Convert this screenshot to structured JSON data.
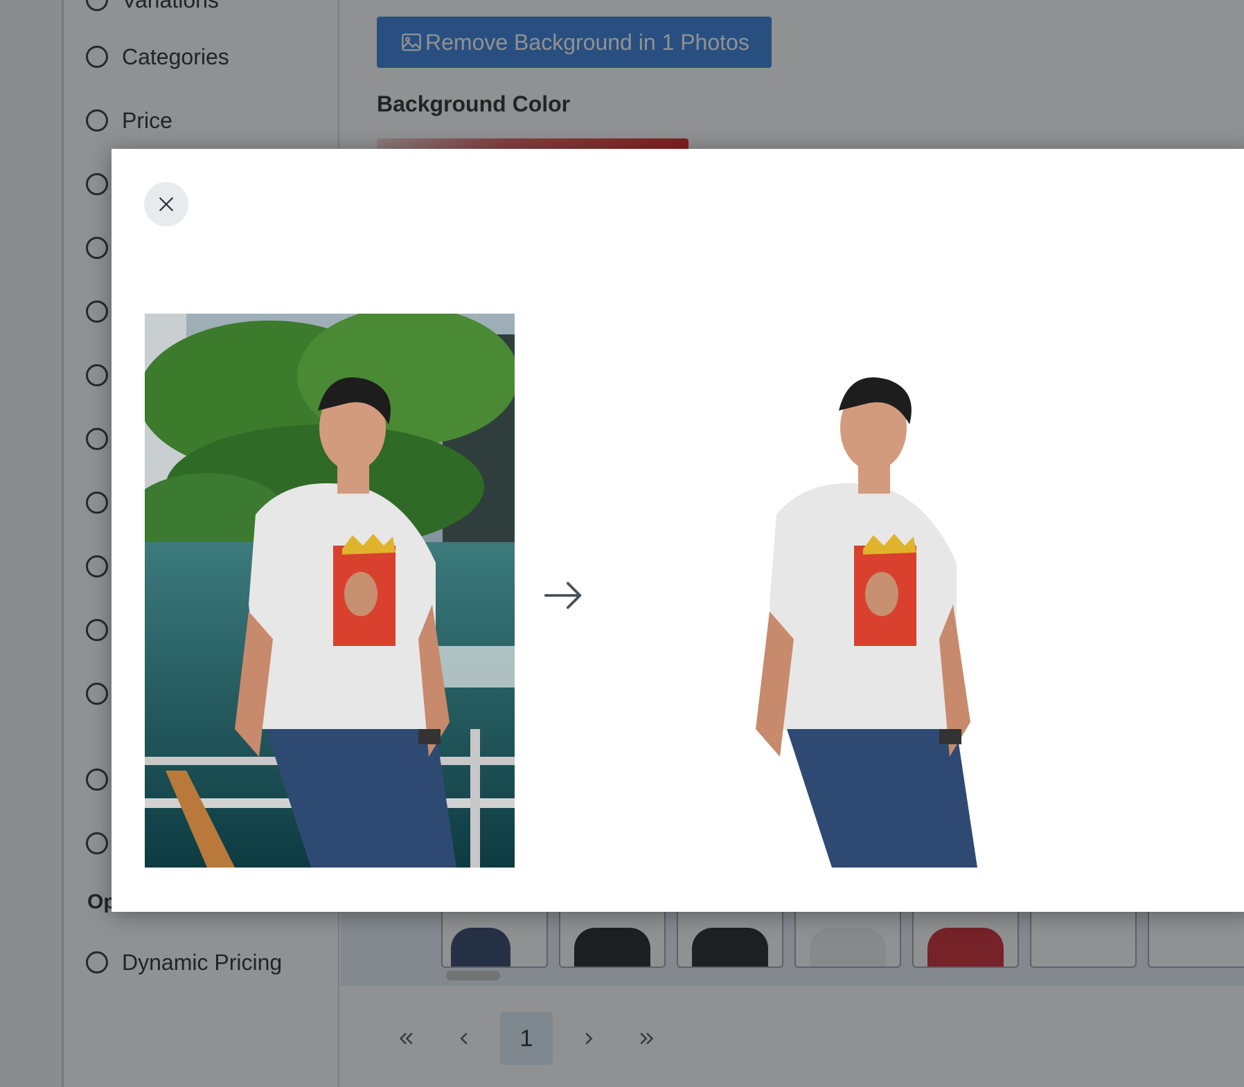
{
  "sidebar": {
    "items": [
      {
        "label": "Variations"
      },
      {
        "label": "Categories"
      },
      {
        "label": "Price"
      },
      {
        "label": ""
      },
      {
        "label": ""
      },
      {
        "label": ""
      },
      {
        "label": ""
      },
      {
        "label": ""
      },
      {
        "label": ""
      },
      {
        "label": ""
      },
      {
        "label": ""
      },
      {
        "label": ""
      },
      {
        "label": ""
      },
      {
        "label": ""
      }
    ],
    "section_heading": "Op",
    "section_items": [
      {
        "label": "Dynamic Pricing"
      }
    ]
  },
  "main": {
    "remove_bg_button_label": "Remove Background in 1 Photos",
    "background_color_heading": "Background Color",
    "swatch_color": "#e21b1b",
    "thumbnails": [
      {
        "shirt_color": "#2c3e66"
      },
      {
        "shirt_color": "#1a1a1a"
      },
      {
        "shirt_color": "#1c1c1c"
      },
      {
        "shirt_color": "#f0f0f0"
      },
      {
        "shirt_color": "#c8202a"
      },
      {
        "shirt_color": ""
      },
      {
        "shirt_color": ""
      }
    ]
  },
  "pagination": {
    "first_icon": "double-chevron-left-icon",
    "prev_icon": "chevron-left-icon",
    "current_page": "1",
    "next_icon": "chevron-right-icon",
    "last_icon": "double-chevron-right-icon"
  },
  "modal": {
    "close_icon": "close-icon",
    "arrow_icon": "arrow-right-icon",
    "accent_color": "#2f7bdb"
  }
}
